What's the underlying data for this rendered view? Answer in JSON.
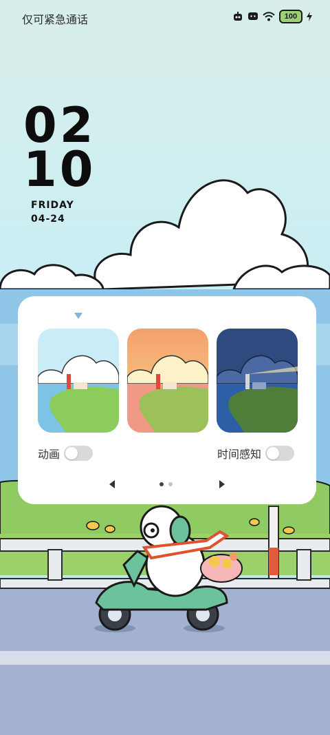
{
  "status_bar": {
    "text": "仅可紧急通话",
    "battery": "100",
    "icons": [
      "robot-icon",
      "chat-icon",
      "wifi-icon",
      "battery-icon",
      "charging-icon"
    ]
  },
  "clock": {
    "hours": "02",
    "minutes": "10",
    "weekday": "FRIDAY",
    "date": "04-24"
  },
  "panel": {
    "thumbnails": [
      "wallpaper-day",
      "wallpaper-sunset",
      "wallpaper-night"
    ],
    "toggles": [
      {
        "label": "动画",
        "on": false
      },
      {
        "label": "时间感知",
        "on": false
      }
    ],
    "pager": {
      "pages": 2,
      "current": 1
    }
  },
  "colors": {
    "sky": "#cfeef3",
    "road": "#a3b2d1",
    "grass": "#9bd06a",
    "scooter": "#6cc29a"
  }
}
